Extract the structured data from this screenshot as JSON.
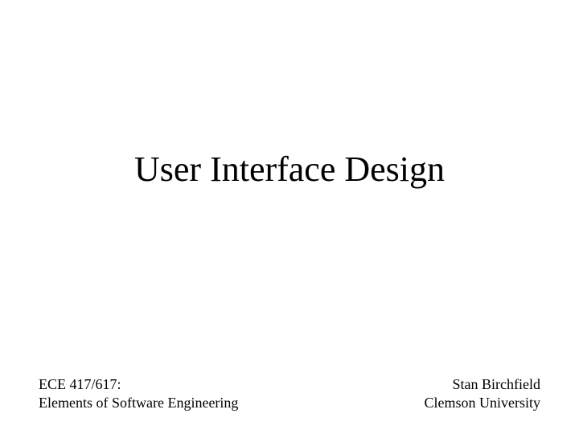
{
  "title": "User Interface Design",
  "footer": {
    "left": {
      "line1": "ECE 417/617:",
      "line2": "Elements of Software Engineering"
    },
    "right": {
      "line1": "Stan Birchfield",
      "line2": "Clemson University"
    }
  }
}
